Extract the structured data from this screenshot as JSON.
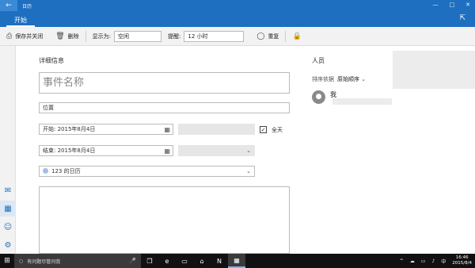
{
  "titlebar": {
    "back": "←",
    "title": "日历",
    "minimize": "—",
    "maximize": "□",
    "close": "✕"
  },
  "ribbon": {
    "tab": "开始",
    "expand_icon": "⇱"
  },
  "toolbar": {
    "save_close": "保存并关闭",
    "delete": "删除",
    "show_as_label": "显示为:",
    "show_as_value": "空闲",
    "reminder_label": "提醒:",
    "reminder_value": "12 小时",
    "repeat": "重复"
  },
  "details": {
    "title": "详细信息",
    "event_name_placeholder": "事件名称",
    "location_placeholder": "位置",
    "start_label": "开始:",
    "start_date": "2015年8月4日",
    "end_label": "结束:",
    "end_date": "2015年8月4日",
    "all_day": "全天",
    "all_day_checked": true,
    "calendar": "123 的日历"
  },
  "people": {
    "title": "人员",
    "sort_label": "排序依据",
    "sort_value": "原始顺序",
    "me": "我"
  },
  "taskbar": {
    "search_placeholder": "有问题尽管问我",
    "ime": "中",
    "time": "16:46",
    "date": "2015/8/4"
  }
}
